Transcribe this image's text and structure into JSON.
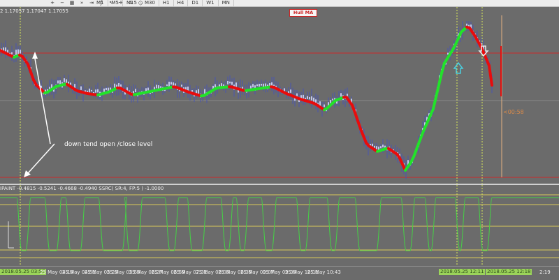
{
  "toolbar": {
    "icons": [
      "zoom-in-icon",
      "zoom-out-icon",
      "grid-icon",
      "autoscroll-icon",
      "chart-shift-icon",
      "indicators-icon",
      "arrow-cursor-icon",
      "crosshair-icon",
      "text-tool-icon",
      "periods-icon"
    ],
    "icon_glyphs": [
      "+",
      "−",
      "▦",
      "»",
      "⇥",
      "ƒ",
      "↖",
      "✛",
      "A",
      "◷"
    ],
    "timeframes": [
      "M1",
      "M5",
      "M15",
      "M30",
      "H1",
      "H4",
      "D1",
      "W1",
      "MN"
    ]
  },
  "main_chart": {
    "ohlc_text": "2 1.17057 1.17047 1.17055",
    "indicator_badge": "Hull MA",
    "annotation": "down tend open /close level",
    "countdown": "<00:58",
    "colors": {
      "background": "#6b6b6b",
      "candles": "#4a56b0",
      "hull_up": "#22e22a",
      "hull_down": "#e80c0c",
      "levels": "#cc2a2a",
      "vlines": "#d9e85a"
    }
  },
  "indicator_pane": {
    "label": "IPAINT -0.4815 -0.5241 -0.4668 -0.4940  SSRC( SR:4, FP:5 ) -1.0000",
    "line_color": "#46d046",
    "level_color": "#d8c85a"
  },
  "time_axis": {
    "start_highlight": "2018.05.25 03:57",
    "ticks": [
      "25 May 04:19",
      "25 May 04:51",
      "25 May 05:23",
      "25 May 05:55",
      "25 May 06:27",
      "25 May 06:59",
      "25 May 07:31",
      "25 May 08:03",
      "25 May 08:35",
      "25 May 09:07",
      "25 May 09:39",
      "25 May 10:11",
      "25 May 10:43"
    ],
    "end_highlights": [
      "2018.05.25 12:11",
      "2018.05.25 12:18"
    ],
    "end_tail": "2:19"
  }
}
